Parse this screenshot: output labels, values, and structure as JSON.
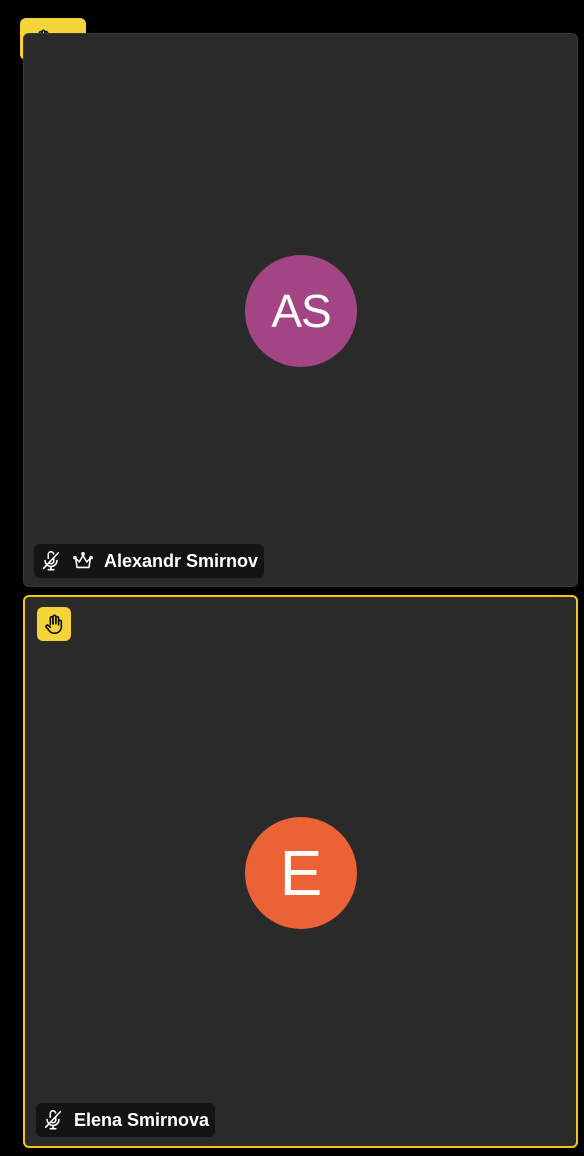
{
  "raised_hands": {
    "count": "1",
    "icon": "raised-hand-icon",
    "color": "#f5d43a"
  },
  "participants": [
    {
      "name": "Alexandr Smirnov",
      "initials": "AS",
      "avatar_color": "#a34585",
      "muted": true,
      "is_host": true,
      "hand_raised": false
    },
    {
      "name": "Elena Smirnova",
      "initials": "E",
      "avatar_color": "#ea6236",
      "muted": true,
      "is_host": false,
      "hand_raised": true,
      "active_border_color": "#f5c518"
    }
  ]
}
